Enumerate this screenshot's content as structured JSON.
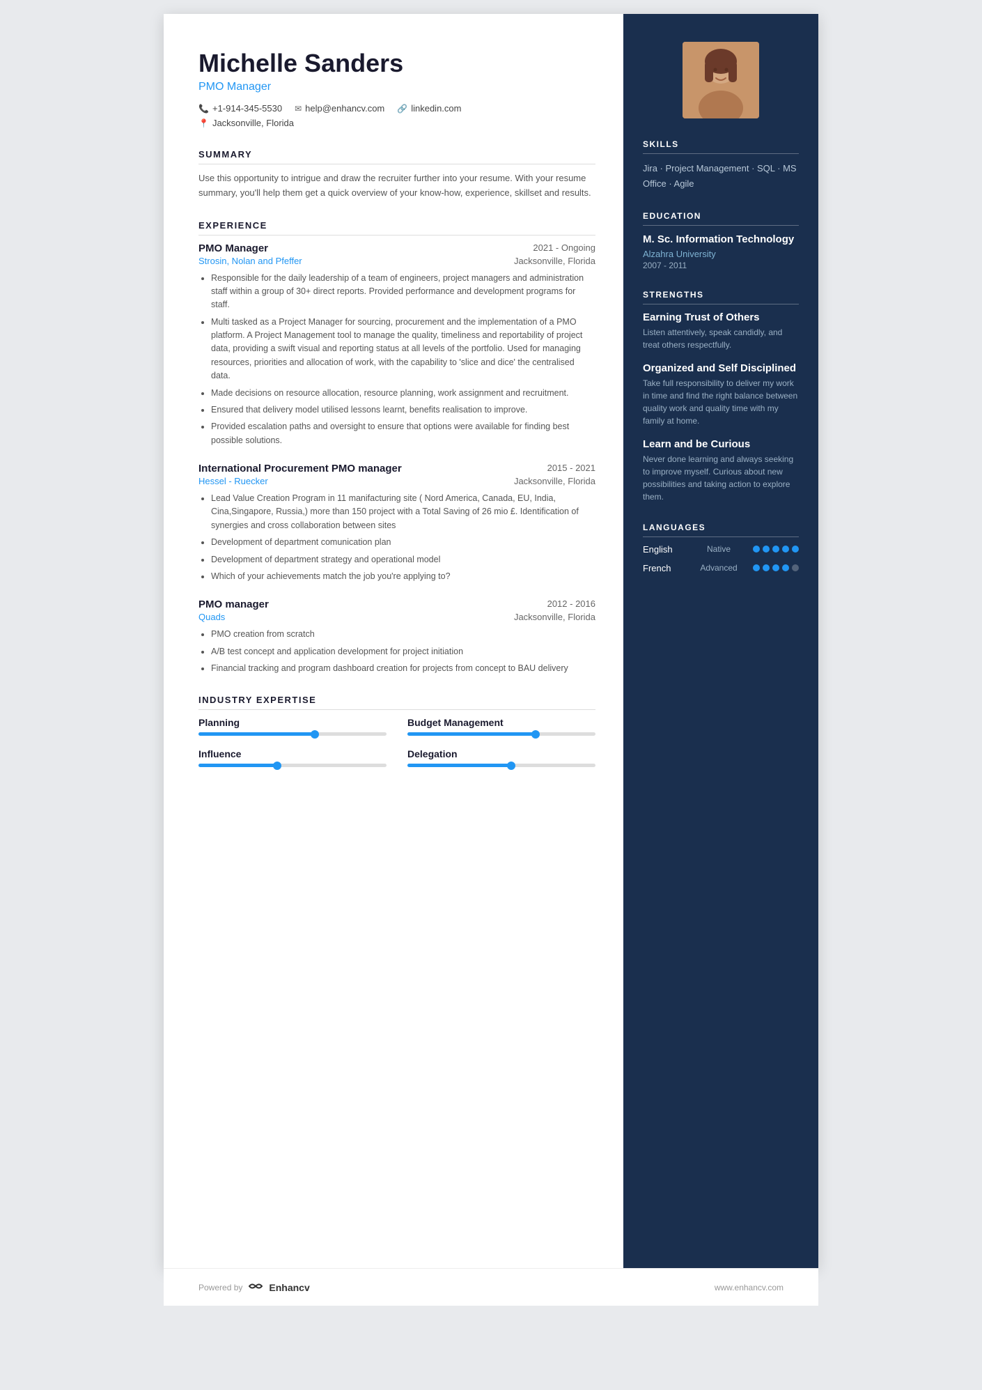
{
  "header": {
    "name": "Michelle Sanders",
    "job_title": "PMO Manager",
    "phone": "+1-914-345-5530",
    "email": "help@enhancv.com",
    "website": "linkedin.com",
    "location": "Jacksonville, Florida"
  },
  "summary": {
    "title": "SUMMARY",
    "text": "Use this opportunity to intrigue and draw the recruiter further into your resume. With your resume summary, you'll help them get a quick overview of your know-how, experience, skillset and results."
  },
  "experience": {
    "title": "EXPERIENCE",
    "items": [
      {
        "role": "PMO Manager",
        "dates": "2021 - Ongoing",
        "company": "Strosin, Nolan and Pfeffer",
        "location": "Jacksonville, Florida",
        "bullets": [
          "Responsible for the daily leadership of a team of engineers, project managers and administration staff within a group of 30+ direct reports. Provided performance and development programs for staff.",
          "Multi tasked as a Project Manager for sourcing, procurement and the implementation of a PMO platform. A Project Management tool to manage the quality, timeliness and reportability of project data, providing a swift visual and reporting status at all levels of the portfolio. Used for managing resources, priorities and allocation of work, with the capability to 'slice and dice' the centralised data.",
          "Made decisions on resource allocation, resource planning, work assignment and recruitment.",
          "Ensured that delivery model utilised lessons learnt, benefits realisation to improve.",
          "Provided escalation paths and oversight to ensure that options were available for finding best possible solutions."
        ]
      },
      {
        "role": "International Procurement PMO manager",
        "dates": "2015 - 2021",
        "company": "Hessel - Ruecker",
        "location": "Jacksonville, Florida",
        "bullets": [
          "Lead Value Creation Program in 11 manifacturing site ( Nord America, Canada, EU, India, Cina,Singapore, Russia,) more than 150 project with a Total Saving of 26 mio £. Identification of synergies and cross collaboration between sites",
          "Development of department comunication plan",
          "Development of department strategy and operational model",
          "Which of your achievements match the job you're applying to?"
        ]
      },
      {
        "role": "PMO manager",
        "dates": "2012 - 2016",
        "company": "Quads",
        "location": "Jacksonville, Florida",
        "bullets": [
          "PMO creation from scratch",
          "A/B test concept and application development for project initiation",
          "Financial tracking and program dashboard creation for projects from concept to BAU delivery"
        ]
      }
    ]
  },
  "industry_expertise": {
    "title": "INDUSTRY EXPERTISE",
    "items": [
      {
        "label": "Planning",
        "percent": 62
      },
      {
        "label": "Budget Management",
        "percent": 68
      },
      {
        "label": "Influence",
        "percent": 42
      },
      {
        "label": "Delegation",
        "percent": 55
      }
    ]
  },
  "skills": {
    "title": "SKILLS",
    "text": "Jira · Project Management · SQL · MS Office · Agile"
  },
  "education": {
    "title": "EDUCATION",
    "degree": "M. Sc. Information Technology",
    "school": "Alzahra University",
    "years": "2007 - 2011"
  },
  "strengths": {
    "title": "STRENGTHS",
    "items": [
      {
        "title": "Earning Trust of Others",
        "desc": "Listen attentively, speak candidly, and treat others respectfully."
      },
      {
        "title": "Organized and Self Disciplined",
        "desc": "Take full responsibility to deliver my work in time and find the right balance between quality work and quality time with my family at home."
      },
      {
        "title": "Learn and be Curious",
        "desc": "Never done learning and always seeking to improve myself. Curious about new possibilities and taking action to explore them."
      }
    ]
  },
  "languages": {
    "title": "LANGUAGES",
    "items": [
      {
        "name": "English",
        "level": "Native",
        "filled": 5,
        "total": 5
      },
      {
        "name": "French",
        "level": "Advanced",
        "filled": 4,
        "total": 5
      }
    ]
  },
  "footer": {
    "powered_by": "Powered by",
    "brand": "Enhancv",
    "website": "www.enhancv.com"
  }
}
